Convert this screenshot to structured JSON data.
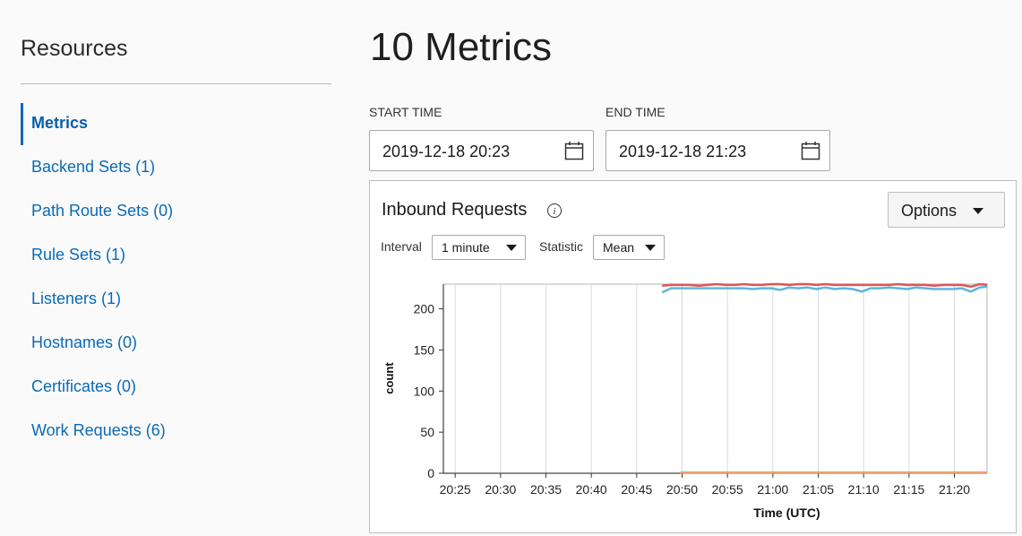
{
  "sidebar": {
    "title": "Resources",
    "items": [
      {
        "label": "Metrics",
        "active": true
      },
      {
        "label": "Backend Sets (1)"
      },
      {
        "label": "Path Route Sets (0)"
      },
      {
        "label": "Rule Sets (1)"
      },
      {
        "label": "Listeners (1)"
      },
      {
        "label": "Hostnames (0)"
      },
      {
        "label": "Certificates (0)"
      },
      {
        "label": "Work Requests (6)"
      }
    ]
  },
  "main": {
    "title": "10 Metrics",
    "start_label": "START TIME",
    "start_value": "2019-12-18 20:23",
    "end_label": "END TIME",
    "end_value": "2019-12-18 21:23"
  },
  "panel": {
    "title": "Inbound Requests",
    "options_label": "Options",
    "interval_label": "Interval",
    "interval_value": "1 minute",
    "statistic_label": "Statistic",
    "statistic_value": "Mean"
  },
  "chart_data": {
    "type": "line",
    "xlabel": "Time (UTC)",
    "ylabel": "count",
    "ylim": [
      0,
      230
    ],
    "yticks": [
      0,
      50,
      100,
      150,
      200
    ],
    "xticks": [
      "20:25",
      "20:30",
      "20:35",
      "20:40",
      "20:45",
      "20:50",
      "20:55",
      "21:00",
      "21:05",
      "21:10",
      "21:15",
      "21:20"
    ],
    "x_range_minutes": [
      23.7,
      83.6
    ],
    "grid": "vertical",
    "series": [
      {
        "color": "#e05555",
        "x": [
          47.8,
          48.8,
          49.8,
          50.8,
          51.8,
          52.8,
          53.8,
          54.8,
          55.8,
          56.8,
          57.8,
          58.8,
          59.8,
          60.8,
          61.8,
          62.8,
          63.8,
          64.8,
          65.8,
          66.8,
          67.8,
          68.8,
          69.8,
          70.8,
          71.8,
          72.8,
          73.8,
          74.8,
          75.8,
          76.8,
          77.8,
          78.8,
          79.8,
          80.8,
          81.8,
          82.8,
          83.6
        ],
        "y": [
          228,
          229,
          229,
          229,
          228,
          229,
          230,
          229,
          229,
          230,
          229,
          229,
          230,
          230,
          229,
          230,
          230,
          229,
          230,
          229,
          229,
          229,
          229,
          229,
          229,
          229,
          230,
          229,
          229,
          229,
          228,
          229,
          229,
          229,
          227,
          230,
          229
        ]
      },
      {
        "color": "#5fb5dc",
        "x": [
          47.8,
          48.8,
          49.8,
          50.8,
          51.8,
          52.8,
          53.8,
          54.8,
          55.8,
          56.8,
          57.8,
          58.8,
          59.8,
          60.8,
          61.8,
          62.8,
          63.8,
          64.8,
          65.8,
          66.8,
          67.8,
          68.8,
          69.8,
          70.8,
          71.8,
          72.8,
          73.8,
          74.8,
          75.8,
          76.8,
          77.8,
          78.8,
          79.8,
          80.8,
          81.8,
          82.8,
          83.6
        ],
        "y": [
          220,
          225,
          225,
          225,
          225,
          225,
          225,
          225,
          225,
          225,
          224,
          225,
          225,
          223,
          226,
          225,
          226,
          224,
          226,
          224,
          225,
          224,
          221,
          225,
          225,
          226,
          225,
          224,
          226,
          225,
          224,
          224,
          224,
          225,
          221,
          226,
          227
        ]
      },
      {
        "color": "#f0a070",
        "x": [
          49.8,
          83.6
        ],
        "y": [
          1,
          1
        ]
      }
    ]
  }
}
